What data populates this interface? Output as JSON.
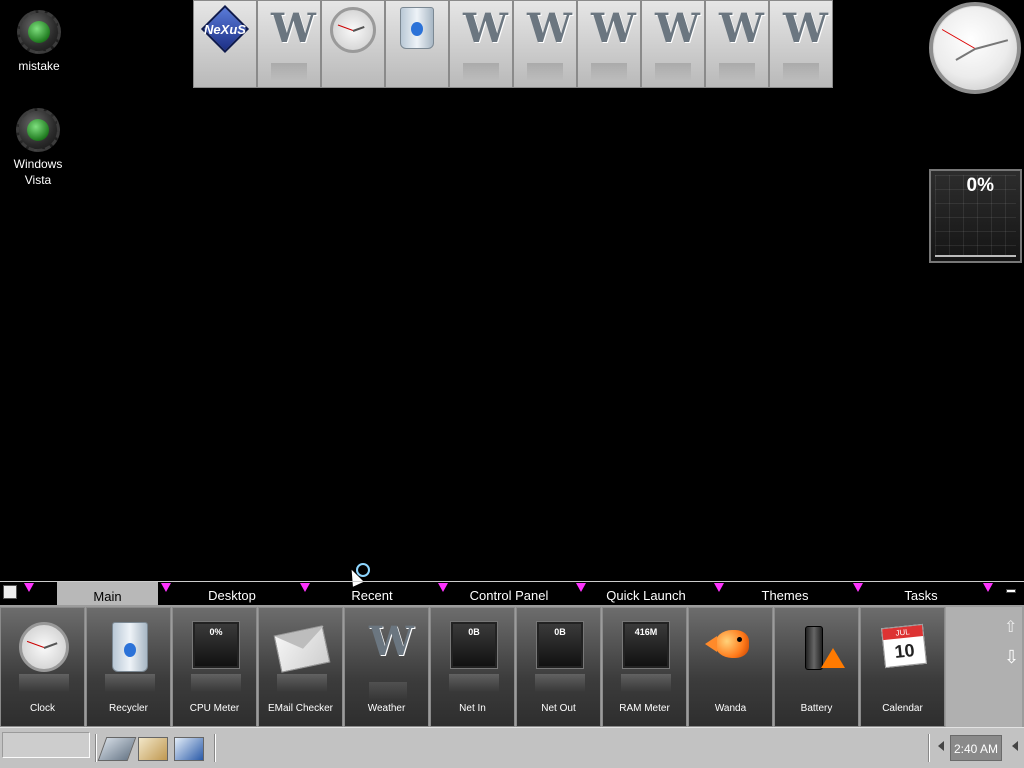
{
  "desktop_icons": [
    {
      "label": "mistake"
    },
    {
      "label": "Windows Vista"
    }
  ],
  "top_dock": {
    "items": [
      "nexus",
      "winstep",
      "clock",
      "recycler",
      "winstep",
      "winstep",
      "winstep",
      "winstep",
      "winstep",
      "winstep"
    ],
    "nexus_text": "NeXuS",
    "w_glyph": "W"
  },
  "cpu_gadget": {
    "value": "0%"
  },
  "tabs": [
    {
      "label": "Main",
      "active": true
    },
    {
      "label": "Desktop",
      "active": false
    },
    {
      "label": "Recent",
      "active": false
    },
    {
      "label": "Control Panel",
      "active": false
    },
    {
      "label": "Quick Launch",
      "active": false
    },
    {
      "label": "Themes",
      "active": false
    },
    {
      "label": "Tasks",
      "active": false
    }
  ],
  "tiles": [
    {
      "label": "Clock",
      "icon": "clock-icon"
    },
    {
      "label": "Recycler",
      "icon": "recycle-bin-icon"
    },
    {
      "label": "CPU Meter",
      "icon": "meter-icon",
      "value": "0%"
    },
    {
      "label": "EMail Checker",
      "icon": "envelope-icon"
    },
    {
      "label": "Weather",
      "icon": "winstep-icon"
    },
    {
      "label": "Net In",
      "icon": "meter-icon",
      "value": "0B"
    },
    {
      "label": "Net Out",
      "icon": "meter-icon",
      "value": "0B"
    },
    {
      "label": "RAM Meter",
      "icon": "meter-icon",
      "value": "416M"
    },
    {
      "label": "Wanda",
      "icon": "fish-icon"
    },
    {
      "label": "Battery",
      "icon": "battery-icon"
    },
    {
      "label": "Calendar",
      "icon": "calendar-icon",
      "month": "JUL",
      "day": "10"
    }
  ],
  "taskbar": {
    "time": "2:40 AM"
  },
  "colors": {
    "tab_marker": "#ff33ff",
    "panel_bg": "#9c9c9c",
    "taskbar_bg": "#c2c2c2"
  }
}
